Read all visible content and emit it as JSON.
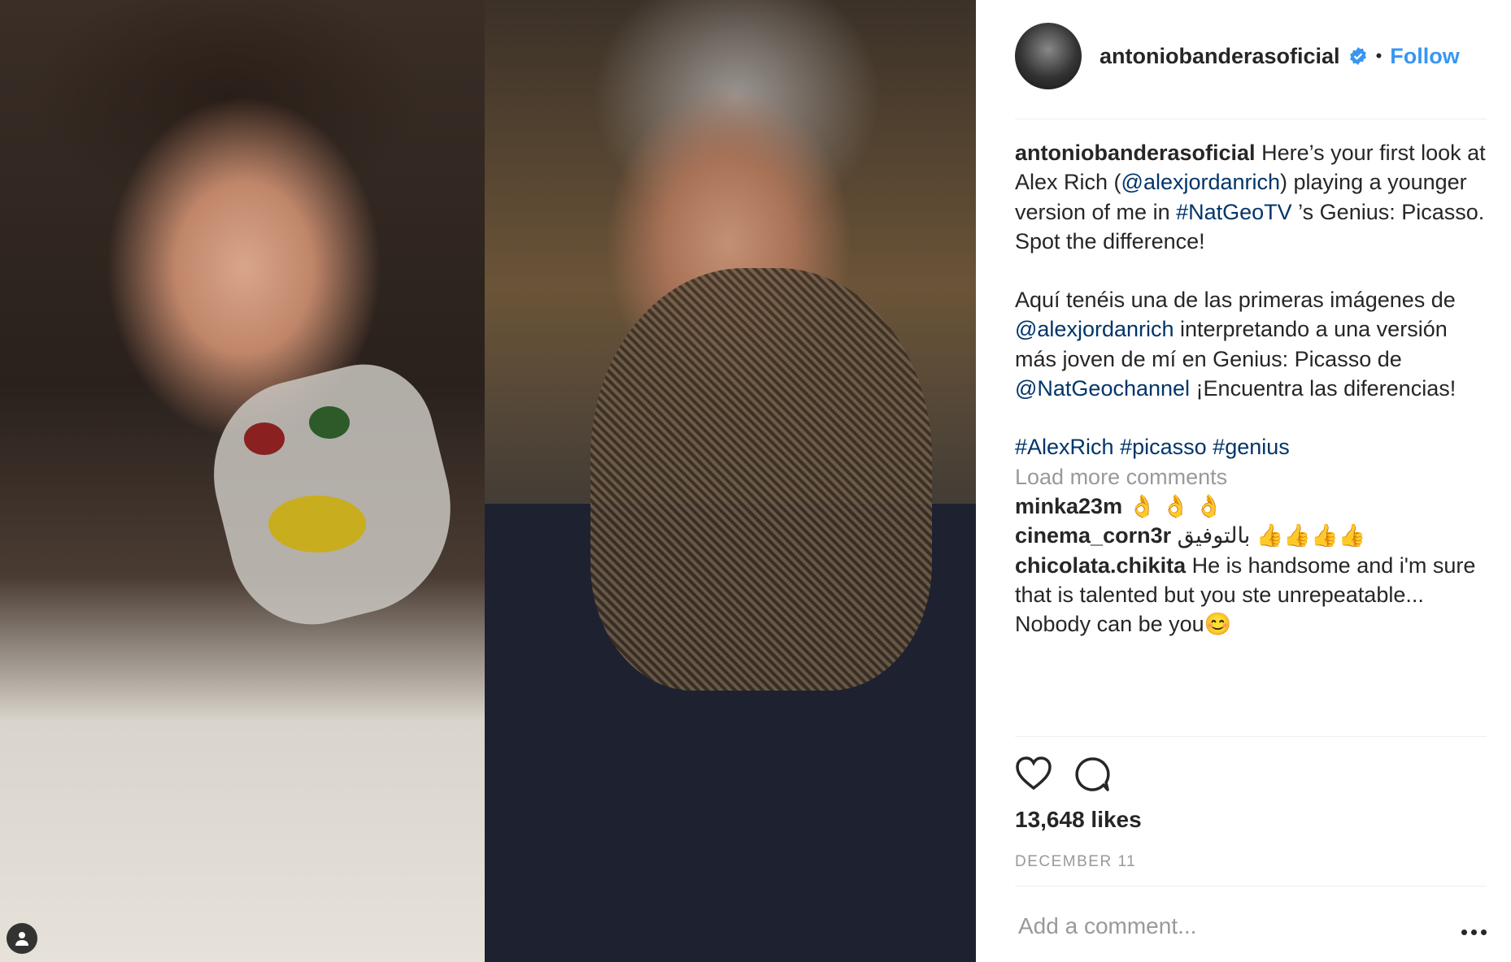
{
  "post": {
    "username": "antoniobanderasoficial",
    "follow_label": "Follow",
    "separator": "•",
    "caption": {
      "author": "antoniobanderasoficial",
      "l1_a": " Here’s your first look at Alex Rich (",
      "l1_mention": "@alexjordanrich",
      "l1_b": ") playing a younger version of me in ",
      "l1_tag": "#NatGeoTV",
      "l1_c": " ’s Genius: Picasso.",
      "l2": "Spot the difference!",
      "es_a": "Aquí tenéis una de las primeras imágenes de ",
      "es_mention1": "@alexjordanrich",
      "es_b": " interpretando a una versión más joven de mí en Genius: Picasso de ",
      "es_mention2": "@NatGeochannel",
      "es_c": " ¡Encuentra las diferencias!",
      "tag1": "#AlexRich",
      "tag2": "#picasso",
      "tag3": "#genius"
    },
    "load_more": "Load more comments",
    "comments": [
      {
        "user": "minka23m",
        "text": " 👌 👌 👌"
      },
      {
        "user": "cinema_corn3r",
        "text": " بالتوفيق 👍👍👍👍"
      },
      {
        "user": "chicolata.chikita",
        "text": " He is handsome and i'm sure that is talented but you ste unrepeatable... Nobody can be you😊"
      }
    ],
    "likes": "13,648 likes",
    "date": "DECEMBER 11",
    "comment_placeholder": "Add a comment...",
    "icons": {
      "verified": "verified-badge-icon",
      "like": "heart-icon",
      "comment": "comment-bubble-icon",
      "options": "more-options-icon",
      "tagged_user": "user-tag-icon"
    },
    "colors": {
      "link": "#003569",
      "follow": "#3897f0",
      "muted": "#999999",
      "text": "#262626"
    }
  }
}
